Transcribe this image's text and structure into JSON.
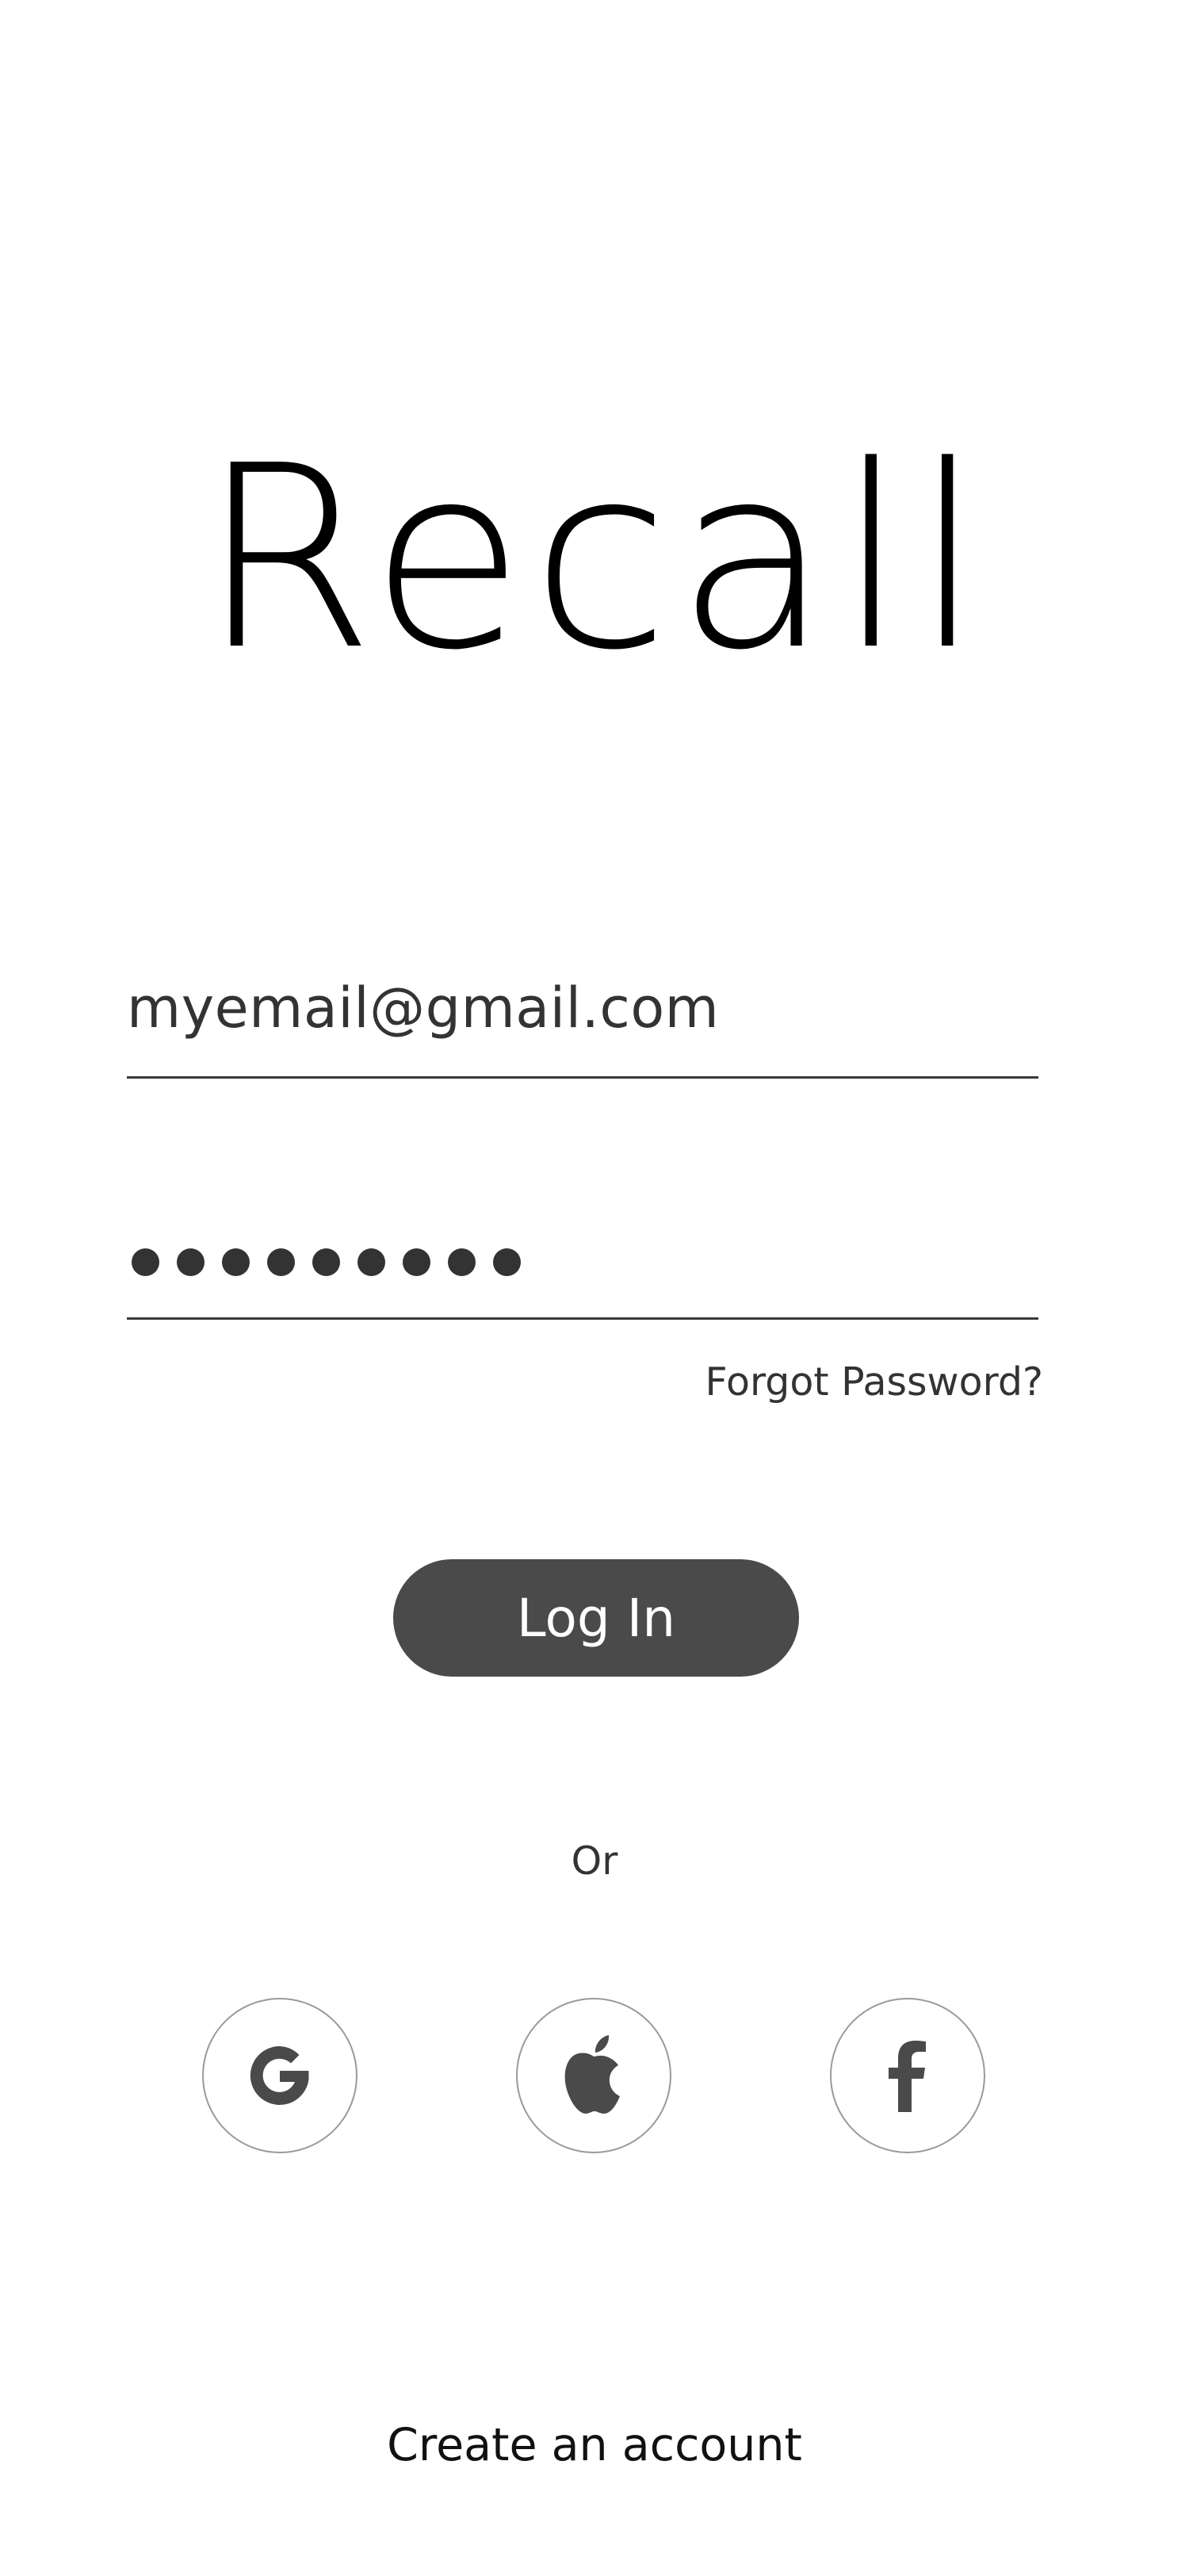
{
  "app": {
    "title": "Recall"
  },
  "login_form": {
    "email_value": "myemail@gmail.com",
    "password_mask": "•••••••••",
    "forgot_password_label": "Forgot Password?",
    "login_button_label": "Log In"
  },
  "social_login": {
    "divider_label": "Or",
    "providers": [
      {
        "name": "Google",
        "icon": "google-icon"
      },
      {
        "name": "Apple",
        "icon": "apple-icon"
      },
      {
        "name": "Facebook",
        "icon": "facebook-icon"
      }
    ]
  },
  "footer": {
    "create_account_label": "Create an account"
  },
  "colors": {
    "background": "#ffffff",
    "text_dark": "#333333",
    "button": "#4a4a4a",
    "button_text": "#ffffff",
    "social_border": "#9a9a9a"
  }
}
